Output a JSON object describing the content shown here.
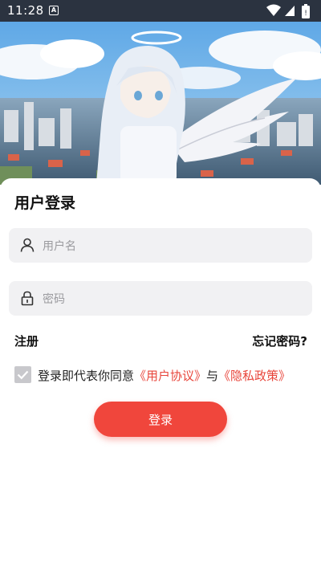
{
  "status_bar": {
    "time": "11:28",
    "app_icon_letter": "A",
    "icons": [
      "wifi-icon",
      "cellular-icon",
      "battery-icon"
    ]
  },
  "hero": {
    "image": "anime angel girl with halo and wings above city"
  },
  "login": {
    "title": "用户登录",
    "username_placeholder": "用户名",
    "password_placeholder": "密码",
    "register_label": "注册",
    "forgot_label": "忘记密码?",
    "agree_checked": true,
    "agree_prefix": "登录即代表你同意",
    "user_agreement": "《用户协议》",
    "agree_and": "与",
    "privacy_policy": "《隐私政策》",
    "submit_label": "登录"
  },
  "colors": {
    "accent": "#f0463c",
    "link_red": "#e8453b",
    "field_bg": "#f1f1f3"
  }
}
